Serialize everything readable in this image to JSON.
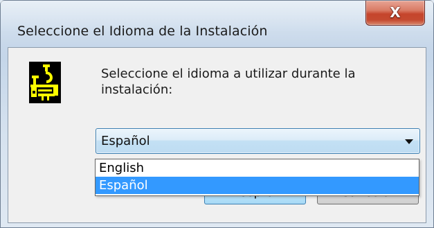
{
  "window": {
    "title": "Seleccione el Idioma de la Instalación",
    "close_label": "X"
  },
  "content": {
    "message": "Seleccione el idioma a utilizar durante la instalación:"
  },
  "language_select": {
    "value": "Español",
    "options": [
      {
        "label": "English",
        "selected": false
      },
      {
        "label": "Español",
        "selected": true
      }
    ]
  },
  "buttons": {
    "accept_label": "Aceptar",
    "cancel_label": "Cancelar"
  },
  "icons": {
    "setup": "installer-icon",
    "close": "close-icon",
    "dropdown": "chevron-down-icon"
  },
  "colors": {
    "selection": "#3399ff",
    "close_button": "#c54a30",
    "logo_fg": "#ffff00",
    "logo_bg": "#000000"
  }
}
